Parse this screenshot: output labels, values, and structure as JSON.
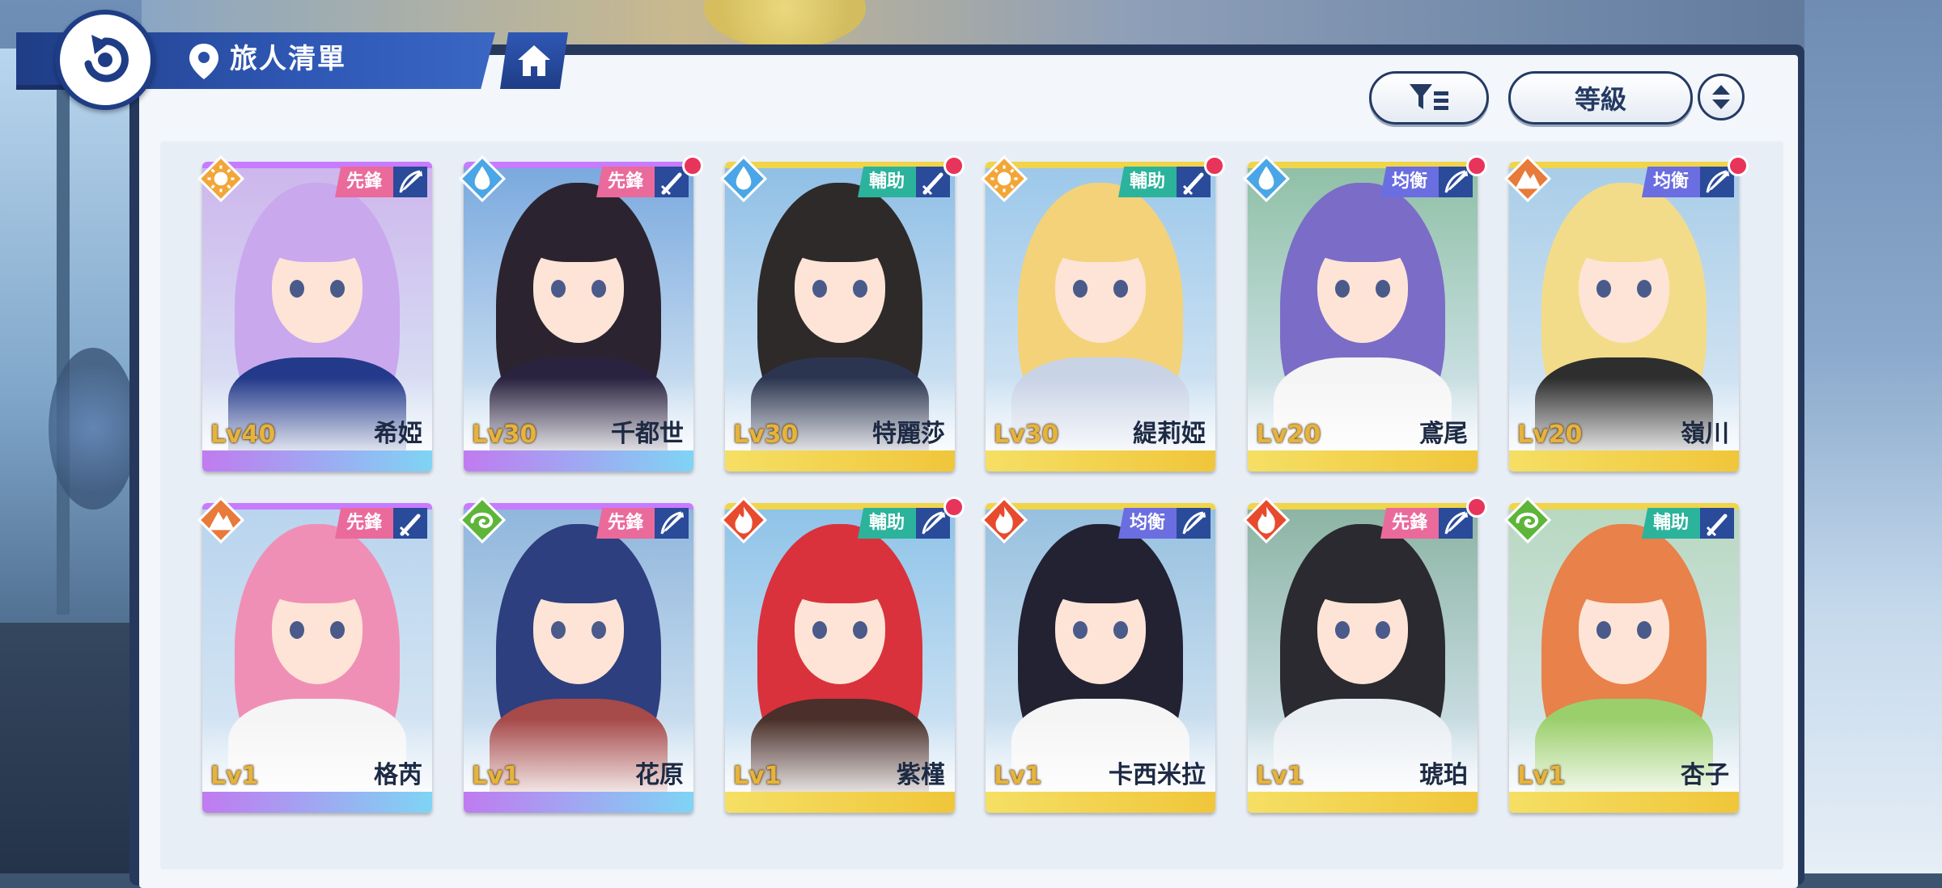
{
  "header": {
    "title": "旅人清單"
  },
  "toolbar": {
    "sort_label": "等級"
  },
  "colors": {
    "navy": "#1f3d86",
    "role_vanguard": "#ea6a9c",
    "role_support": "#2cb39b",
    "role_balance": "#6a6ee0",
    "element_light": "#f2a638",
    "element_water": "#4aa6e6",
    "element_earth": "#e87a3a",
    "element_wind": "#5db53a",
    "element_fire": "#e84a2e",
    "new_dot": "#e8345a"
  },
  "cards": [
    {
      "level": "Lv40",
      "name": "希婭",
      "role": "先鋒",
      "element": "sun-icon",
      "weapon": "bow-icon",
      "new": false
    },
    {
      "level": "Lv30",
      "name": "千都世",
      "role": "先鋒",
      "element": "water-drop-icon",
      "weapon": "sword-icon",
      "new": true
    },
    {
      "level": "Lv30",
      "name": "特麗莎",
      "role": "輔助",
      "element": "water-drop-icon",
      "weapon": "sword-icon",
      "new": true
    },
    {
      "level": "Lv30",
      "name": "緹莉婭",
      "role": "輔助",
      "element": "sun-icon",
      "weapon": "sword-icon",
      "new": true
    },
    {
      "level": "Lv20",
      "name": "鳶尾",
      "role": "均衡",
      "element": "water-drop-icon",
      "weapon": "bow-icon",
      "new": true
    },
    {
      "level": "Lv20",
      "name": "嶺川",
      "role": "均衡",
      "element": "mountain-icon",
      "weapon": "bow-icon",
      "new": true
    },
    {
      "level": "Lv1",
      "name": "格芮",
      "role": "先鋒",
      "element": "mountain-icon",
      "weapon": "sword-icon",
      "new": false
    },
    {
      "level": "Lv1",
      "name": "花原",
      "role": "先鋒",
      "element": "wind-icon",
      "weapon": "bow-icon",
      "new": false
    },
    {
      "level": "Lv1",
      "name": "紫槿",
      "role": "輔助",
      "element": "fire-icon",
      "weapon": "bow-icon",
      "new": true
    },
    {
      "level": "Lv1",
      "name": "卡西米拉",
      "role": "均衡",
      "element": "fire-icon",
      "weapon": "bow-icon",
      "new": false
    },
    {
      "level": "Lv1",
      "name": "琥珀",
      "role": "先鋒",
      "element": "fire-icon",
      "weapon": "bow-icon",
      "new": true
    },
    {
      "level": "Lv1",
      "name": "杏子",
      "role": "輔助",
      "element": "wind-icon",
      "weapon": "sword-icon",
      "new": false
    }
  ]
}
